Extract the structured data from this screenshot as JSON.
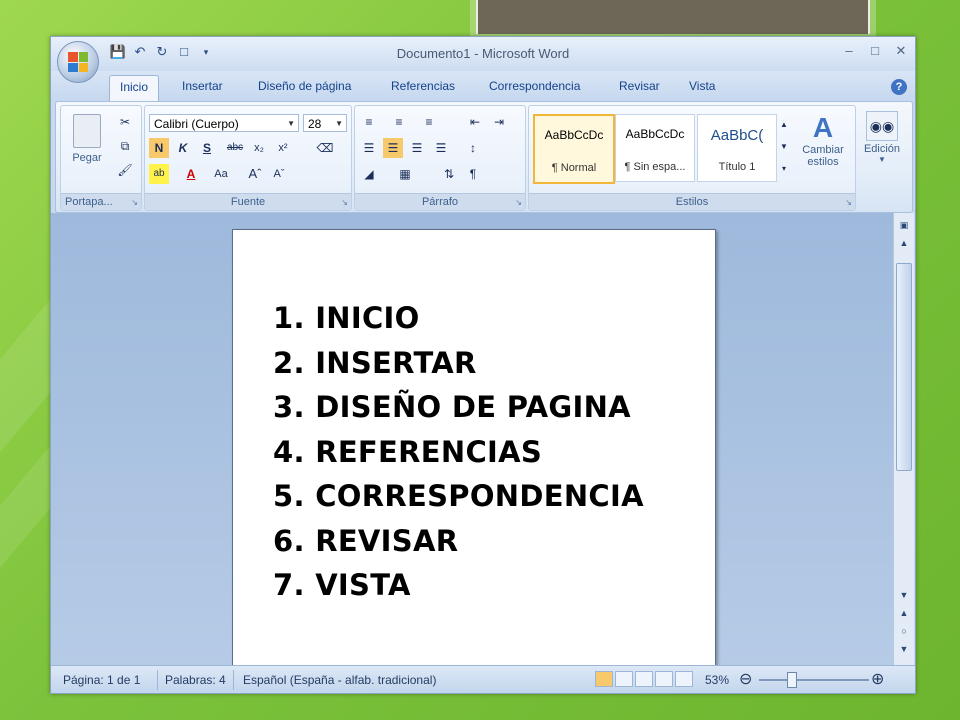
{
  "window": {
    "title": "Documento1 - Microsoft Word"
  },
  "qat": {
    "save_icon": "save-icon",
    "undo_icon": "undo-icon",
    "redo_icon": "redo-icon",
    "new_icon": "new-doc-icon"
  },
  "tabs": [
    "Inicio",
    "Insertar",
    "Diseño de página",
    "Referencias",
    "Correspondencia",
    "Revisar",
    "Vista"
  ],
  "ribbon": {
    "clipboard": {
      "label": "Portapa...",
      "paste": "Pegar"
    },
    "font": {
      "label": "Fuente",
      "name": "Calibri (Cuerpo)",
      "size": "28"
    },
    "paragraph": {
      "label": "Párrafo"
    },
    "styles": {
      "label": "Estilos",
      "items": [
        {
          "preview": "AaBbCcDc",
          "name": "¶ Normal"
        },
        {
          "preview": "AaBbCcDc",
          "name": "¶ Sin espa..."
        },
        {
          "preview": "AaBbC(",
          "name": "Título 1"
        }
      ],
      "change_styles": "Cambiar estilos"
    },
    "editing": {
      "label": "Edición"
    }
  },
  "document": {
    "items": [
      "1. INICIO",
      "2. INSERTAR",
      "3. DISEÑO DE PAGINA",
      "4. REFERENCIAS",
      "5. CORRESPONDENCIA",
      "6. REVISAR",
      "7. VISTA"
    ]
  },
  "status": {
    "page": "Página: 1 de 1",
    "words": "Palabras: 4",
    "language": "Español (España - alfab. tradicional)",
    "zoom": "53%"
  },
  "colors": {
    "slide_bg": "#8ccc45",
    "accent_blue": "#15428b",
    "selected_style": "#f2b73a"
  }
}
